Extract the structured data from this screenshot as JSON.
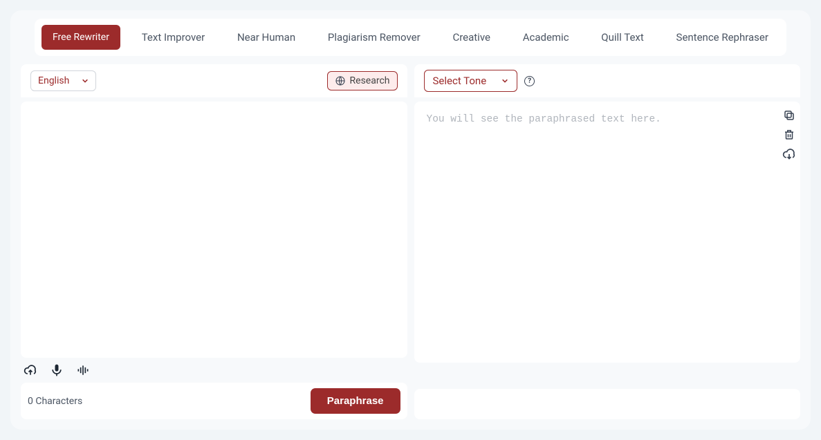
{
  "tabs": {
    "active": "Free Rewriter",
    "items": [
      "Free Rewriter",
      "Text Improver",
      "Near Human",
      "Plagiarism Remover",
      "Creative",
      "Academic",
      "Quill Text",
      "Sentence Rephraser"
    ]
  },
  "left_toolbar": {
    "language": "English",
    "research_label": "Research"
  },
  "right_toolbar": {
    "tone_label": "Select Tone",
    "help_char": "?"
  },
  "output": {
    "placeholder": "You will see the paraphrased text here."
  },
  "footer": {
    "char_count_value": "0",
    "char_count_label": "Characters",
    "paraphrase_label": "Paraphrase"
  },
  "colors": {
    "brand": "#9c2b2b"
  }
}
